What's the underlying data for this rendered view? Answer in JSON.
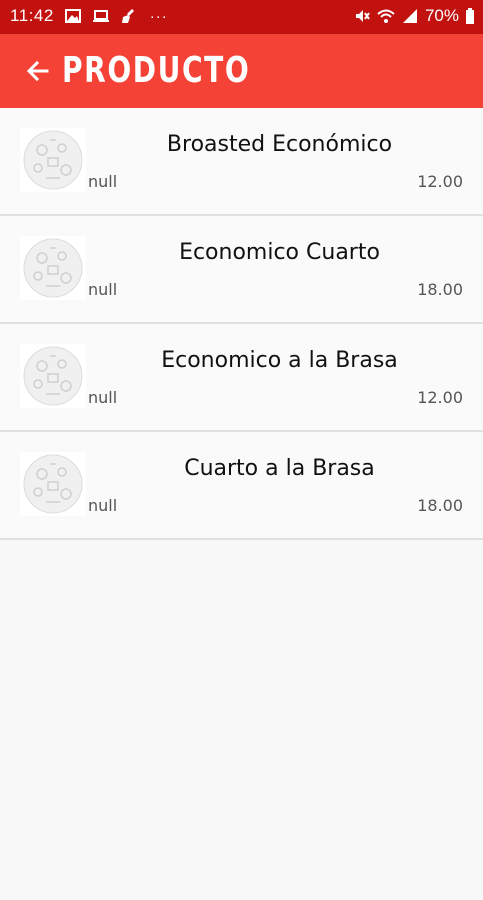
{
  "status_bar": {
    "time": "11:42",
    "battery_text": "70%",
    "dots": "···",
    "icons": [
      "image-icon",
      "laptop-icon",
      "broom-icon",
      "mute-icon",
      "wifi-icon",
      "signal-icon",
      "battery-icon"
    ]
  },
  "app_bar": {
    "title": "PRODUCTO",
    "back_icon": "arrow-left-icon",
    "color": "#f44336"
  },
  "products": [
    {
      "name": "Broasted Económico",
      "description": "null",
      "price": "12.00"
    },
    {
      "name": "Economico Cuarto",
      "description": "null",
      "price": "18.00"
    },
    {
      "name": "Economico a la Brasa",
      "description": "null",
      "price": "12.00"
    },
    {
      "name": "Cuarto a la Brasa",
      "description": "null",
      "price": "18.00"
    }
  ],
  "colors": {
    "status_bar": "#c21210",
    "app_bar": "#f44336",
    "background": "#f8f8f8",
    "divider": "#e0e0e0"
  }
}
